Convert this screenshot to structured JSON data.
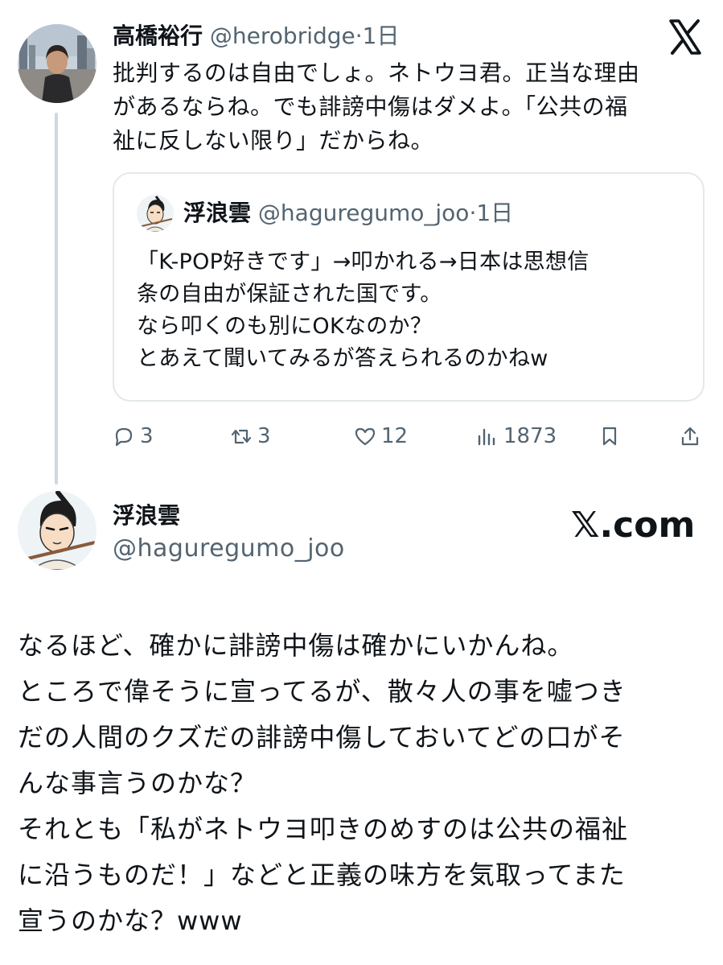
{
  "tweet1": {
    "name": "高橋裕行",
    "handle": "@herobridge",
    "time": "·1日",
    "body_lines": [
      "批判するのは自由でしょ。ネトウヨ君。正当な理由",
      "があるならね。でも誹謗中傷はダメよ。「公共の福",
      "祉に反しない限り」だからね。"
    ],
    "stats": {
      "replies": "3",
      "retweets": "3",
      "likes": "12",
      "views": "1873"
    }
  },
  "quote": {
    "name": "浮浪雲",
    "handle": "@haguregumo_joo",
    "time": "·1日",
    "body_lines": [
      "「K-POP好きです」→叩かれる→日本は思想信",
      "条の自由が保証された国です。",
      "なら叩くのも別にOKなのか？",
      "とあえて聞いてみるが答えられるのかねw"
    ]
  },
  "tweet2": {
    "name": "浮浪雲",
    "handle": "@haguregumo_joo",
    "body_lines": [
      "なるほど、確かに誹謗中傷は確かにいかんね。",
      "ところで偉そうに宣ってるが、散々人の事を嘘つき",
      "だの人間のクズだの誹謗中傷しておいてどの口がそ",
      "んな事言うのかな？",
      "それとも「私がネトウヨ叩きのめすのは公共の福祉",
      "に沿うものだ！」などと正義の味方を気取ってまた",
      "宣うのかな？www"
    ]
  },
  "branding": {
    "xcom": "𝕏.com"
  },
  "icons": {
    "x_logo": "x-logo-icon",
    "reply": "reply-icon",
    "retweet": "retweet-icon",
    "like": "heart-icon",
    "views": "views-icon",
    "bookmark": "bookmark-icon",
    "share": "share-icon"
  },
  "colors": {
    "secondary_text": "#536471",
    "border": "#e3e8eb",
    "thread_line": "#cfd9de"
  }
}
